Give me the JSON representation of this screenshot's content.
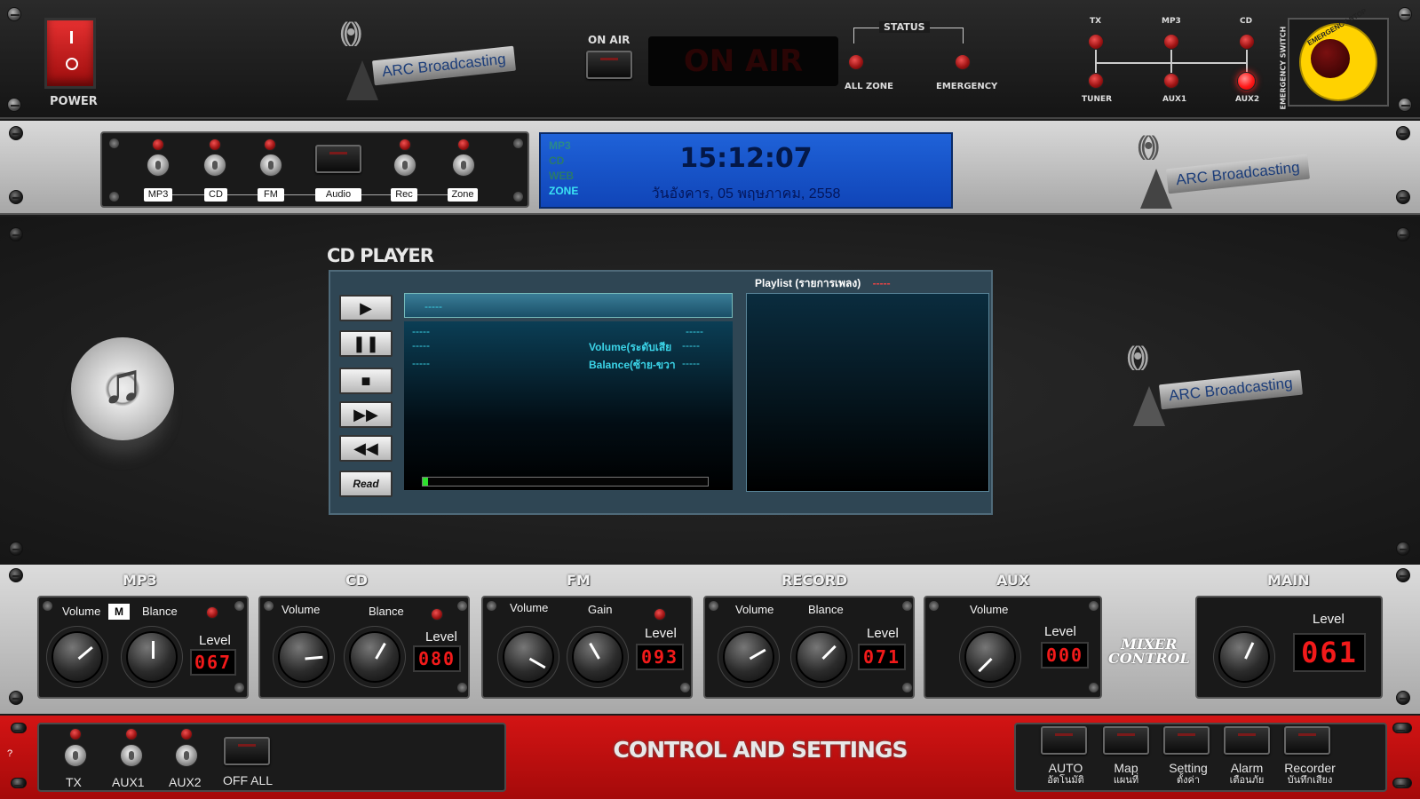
{
  "top": {
    "power_label": "POWER",
    "on_air_label": "ON AIR",
    "on_air_display": "ON AIR",
    "status_label": "STATUS",
    "status_items": [
      "ALL ZONE",
      "EMERGENCY"
    ],
    "emergency_switch_label": "EMERGENCY SWITCH",
    "emergency_stop_label": "EMERGENCY STOP",
    "switch_top": [
      "TX",
      "MP3",
      "CD"
    ],
    "switch_bottom": [
      "TUNER",
      "AUX1",
      "AUX2"
    ],
    "logo_text": "ARC Broadcasting"
  },
  "source": {
    "items": [
      "MP3",
      "CD",
      "FM",
      "Audio",
      "Rec",
      "Zone"
    ]
  },
  "lcd": {
    "side": [
      "MP3",
      "CD",
      "WEB",
      "ZONE"
    ],
    "time": "15:12:07",
    "date": "วันอังคาร, 05 พฤษภาคม, 2558"
  },
  "player": {
    "title": "CD PLAYER",
    "track": "-----",
    "info_left": [
      "-----",
      "-----",
      "-----"
    ],
    "info_right_values": [
      "-----",
      "-----",
      "-----"
    ],
    "volume_label": "Volume(ระดับเสีย",
    "balance_label": "Balance(ซ้าย-ขวา",
    "read_label": "Read",
    "progress": 0.02,
    "playlist_label": "Playlist (รายการเพลง)",
    "playlist_value": "-----"
  },
  "mixer": {
    "channels": [
      {
        "title": "MP3",
        "k1": "Volume",
        "k2": "Blance",
        "level_label": "Level",
        "level": "067",
        "mute": "M"
      },
      {
        "title": "CD",
        "k1": "Volume",
        "k2": "Blance",
        "level_label": "Level",
        "level": "080"
      },
      {
        "title": "FM",
        "k1": "Volume",
        "k2": "Gain",
        "level_label": "Level",
        "level": "093"
      },
      {
        "title": "RECORD",
        "k1": "Volume",
        "k2": "Blance",
        "level_label": "Level",
        "level": "071"
      },
      {
        "title": "AUX",
        "k1": "Volume",
        "level_label": "Level",
        "level": "000"
      },
      {
        "title": "MAIN",
        "level_label": "Level",
        "level": "061"
      }
    ],
    "mixer_control_1": "MIXER",
    "mixer_control_2": "CONTROL"
  },
  "bottom": {
    "outputs": [
      "TX",
      "AUX1",
      "AUX2"
    ],
    "off_all": "OFF ALL",
    "title": "CONTROL AND SETTINGS",
    "settings": [
      {
        "en": "AUTO",
        "th": "อัตโนมัติ"
      },
      {
        "en": "Map",
        "th": "แผนที่"
      },
      {
        "en": "Setting",
        "th": "ตั้งค่า"
      },
      {
        "en": "Alarm",
        "th": "เตือนภัย"
      },
      {
        "en": "Recorder",
        "th": "บันทึกเสียง"
      }
    ],
    "help": "?"
  }
}
